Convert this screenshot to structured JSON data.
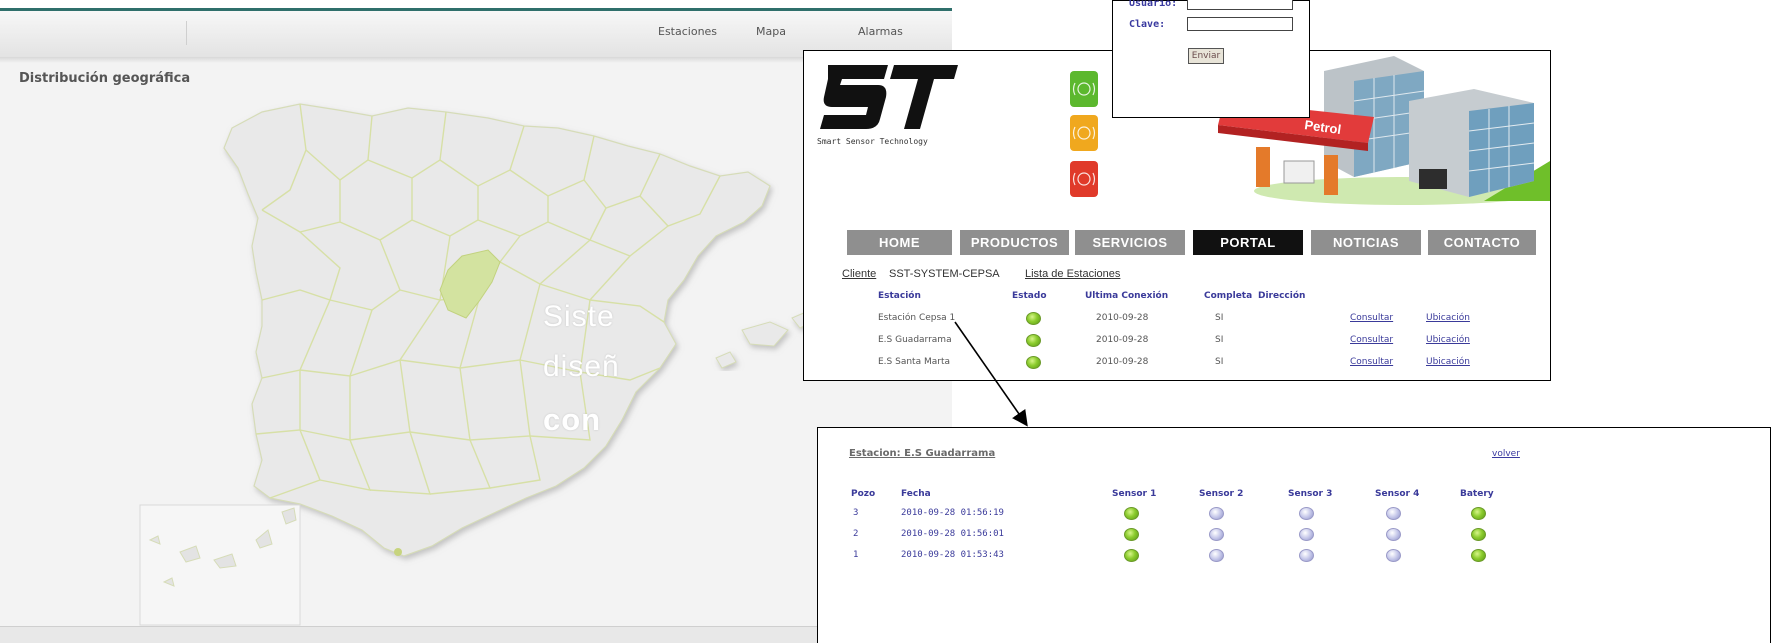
{
  "map_app": {
    "nav": [
      "Estaciones",
      "Mapa",
      "Alarmas"
    ],
    "section_title": "Distribución geográfica",
    "overlay_text": [
      "Siste",
      "diseñ",
      "con"
    ]
  },
  "login": {
    "user_label": "Usuario:",
    "password_label": "Clave:",
    "submit_label": "Enviar"
  },
  "portal": {
    "logo_text": "ST",
    "logo_subtitle": "Smart Sensor Technology",
    "building_sign": "Petrol",
    "alarm_colors": [
      "#5cb82e",
      "#f0a81e",
      "#e03a2a"
    ],
    "menu": [
      "HOME",
      "PRODUCTOS",
      "SERVICIOS",
      "PORTAL",
      "NOTICIAS",
      "CONTACTO"
    ],
    "active_menu": "PORTAL",
    "client_label": "Cliente",
    "client_value": "SST-SYSTEM-CEPSA",
    "stations_link": "Lista de Estaciones",
    "columns": [
      "Estación",
      "Estado",
      "Ultima Conexión",
      "Completa",
      "Dirección"
    ],
    "rows": [
      {
        "station": "Estación Cepsa 1",
        "status": "ok",
        "last_connection": "2010-09-28",
        "complete": "SI",
        "consult": "Consultar",
        "location": "Ubicación"
      },
      {
        "station": "E.S Guadarrama",
        "status": "ok",
        "last_connection": "2010-09-28",
        "complete": "SI",
        "consult": "Consultar",
        "location": "Ubicación"
      },
      {
        "station": "E.S Santa Marta",
        "status": "ok",
        "last_connection": "2010-09-28",
        "complete": "SI",
        "consult": "Consultar",
        "location": "Ubicación"
      }
    ]
  },
  "detail": {
    "title": "Estacion: E.S Guadarrama",
    "back_link": "volver",
    "columns": [
      "Pozo",
      "Fecha",
      "Sensor 1",
      "Sensor 2",
      "Sensor 3",
      "Sensor 4",
      "Batery"
    ],
    "rows": [
      {
        "pozo": "3",
        "fecha": "2010-09-28 01:56:19",
        "sensors": [
          "green",
          "blue",
          "blue",
          "blue",
          "green"
        ]
      },
      {
        "pozo": "2",
        "fecha": "2010-09-28 01:56:01",
        "sensors": [
          "green",
          "blue",
          "blue",
          "blue",
          "green"
        ]
      },
      {
        "pozo": "1",
        "fecha": "2010-09-28 01:53:43",
        "sensors": [
          "green",
          "blue",
          "blue",
          "blue",
          "green"
        ]
      }
    ]
  },
  "colors": {
    "brand_teal": "#2f6f6b",
    "status_green": "#8ccc2e",
    "status_idle": "#c6c8ea",
    "link_blue": "#3a3a9a",
    "highlight_region": "#d3e3a0"
  }
}
